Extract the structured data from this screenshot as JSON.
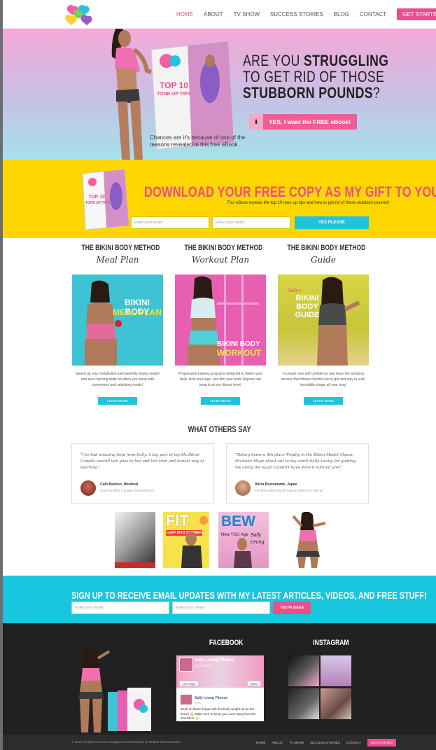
{
  "nav": {
    "items": [
      "HOME",
      "ABOUT",
      "TV SHOW",
      "SUCCESS STORIES",
      "BLOG",
      "CONTACT"
    ],
    "cta": "GET STARTED"
  },
  "hero": {
    "line1_a": "ARE YOU ",
    "line1_b": "STRUGGLING",
    "line2": "TO GET RID OF THOSE",
    "line3": "STUBBORN POUNDS",
    "line3_q": "?",
    "button": "YES, I want the FREE eBook!",
    "sub": "Chances are it's because of one of the reasons revealed in this free eBook.",
    "book_line1": "TOP 10",
    "book_line2": "TONE UP TIPS"
  },
  "download": {
    "title": "DOWNLOAD YOUR FREE COPY AS MY GIFT TO YOU!",
    "sub": "This eBook reveals the top 10 tone up tips and how to get rid of those stubborn pounds!",
    "email_placeholder": "Enter your email",
    "name_placeholder": "Enter your name",
    "button": "YES PLEASE",
    "book_line1": "TOP 10",
    "book_line2": "TONE UP TIPS"
  },
  "products": [
    {
      "heading": "THE BIKINI BODY METHOD",
      "script": "Meal Plan",
      "overlay1": "BIKINI BODY",
      "overlay2": "MEAL PLAN",
      "desc": "Speed up your metabolism permanently, losing weight and even burning body fat when you sleep with convenient and satisfying meals!",
      "button": "LEARN MORE",
      "color": "#3ec3d5"
    },
    {
      "heading": "THE BIKINI BODY METHOD",
      "script": "Workout Plan",
      "overlay1": "BIKINI BODY",
      "overlay2": "WORKOUT",
      "desc": "Progressive training programs designed to flatten your belly, tone your legs, and firm your bum! Anyone can jump in at any fitness level.",
      "button": "LEARN MORE",
      "color": "#e65fb1"
    },
    {
      "heading": "THE BIKINI BODY METHOD",
      "script": "Guide",
      "overlay1": "Sally's",
      "overlay2": "BIKINI BODY GUIDE",
      "desc": "Increase your self confidence and learn the amazing secrets that fitness models use to get and stay in such incredible shape all year long!",
      "button": "LEARN MORE",
      "color": "#d9d23a"
    }
  ],
  "testimonials": {
    "title": "WHAT OTHERS SAY",
    "items": [
      {
        "quote": "\"I've had amazing help from Sally. A big part of my Ms Bikini Canada overall win goes to her and her kind and honest way of teaching.\"",
        "name": "Cath Basiton, Montreal",
        "role": "2015 Ms Bikini Canada Overall Winner"
      },
      {
        "quote": "\"Taking home a 4th place Trophy in the Bikini Model Classic Division! Huge shout out to my coach Sally Leung for guiding me along the way!I couldn't have done it without you!\"",
        "name": "Alicia Bustamante, Japan",
        "role": "4th Place Bikini Model Classic WBFF Pro Winner"
      }
    ]
  },
  "magazines": {
    "m1": "FIT",
    "m1_sub": "LEAP INTO SUMMER",
    "m2": "BEW",
    "m2_sub1": "Sally",
    "m2_sub2": "Leung",
    "m2_sub3": "New YOU Age"
  },
  "signup": {
    "title": "SIGN UP TO RECEIVE EMAIL UPDATES WITH MY LATEST ARTICLES, VIDEOS, AND FREE STUFF!",
    "email_placeholder": "Enter your email",
    "name_placeholder": "Enter your name",
    "button": "YES PLEASE"
  },
  "footer": {
    "facebook_title": "FACEBOOK",
    "instagram_title": "INSTAGRAM",
    "fb_page": "Sally Leung Fitness",
    "fb_likes": "28,237 likes",
    "fb_like_btn": "Like Page",
    "fb_share_btn": "Share",
    "fb_post_name": "Sally Leung Fitness",
    "fb_post_date": "2 hrs",
    "fb_post_text": "Work on these things with this body weight ab do the bench 💪 Make sure to keep your cues away from the shoulders 👌",
    "copyright": "© 2016 All rights reserved. Designed and developed by Bubble Mint Interactive",
    "nav": [
      "HOME",
      "ABOUT",
      "TV SHOW",
      "SUCCESS STORIES",
      "CONTACT"
    ],
    "cta": "GET STARTED"
  },
  "colors": {
    "pink": "#ef4c8b",
    "cyan": "#18c6de",
    "yellow": "#fdd600",
    "dark": "#212121"
  }
}
